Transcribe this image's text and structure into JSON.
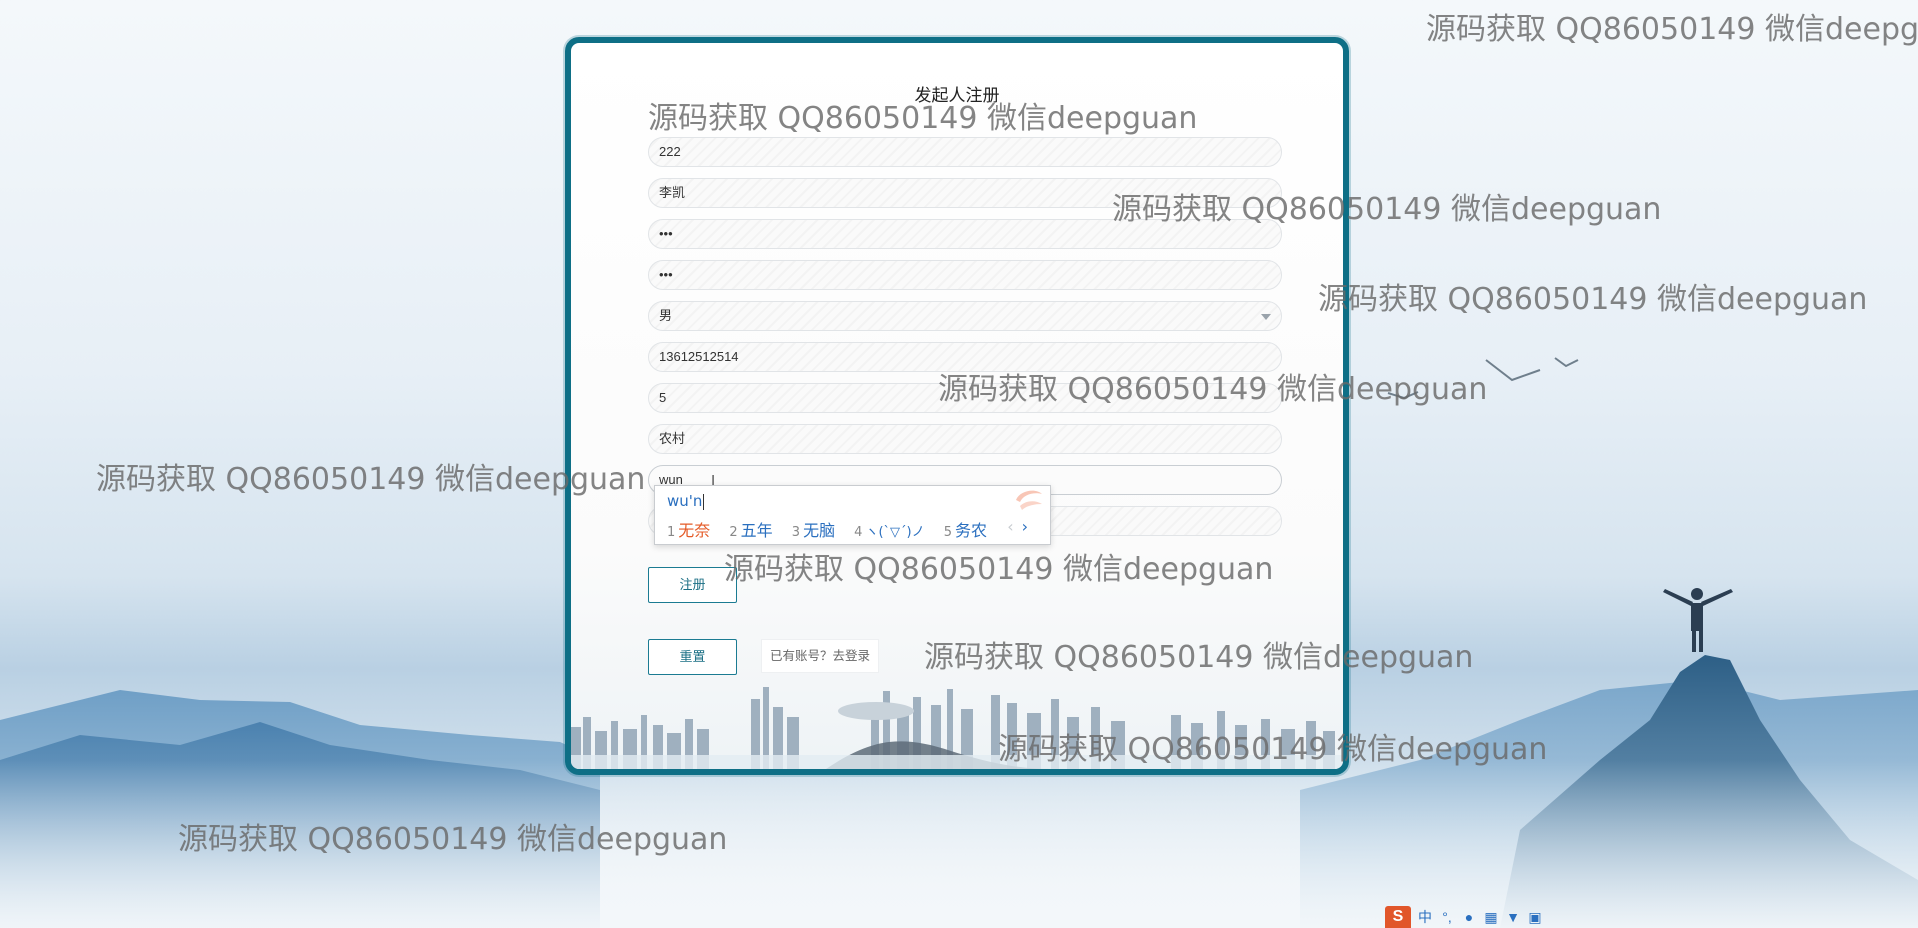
{
  "form": {
    "title": "发起人注册",
    "fields": [
      {
        "name": "account-field",
        "value": "222"
      },
      {
        "name": "name-field",
        "value": "李凯"
      },
      {
        "name": "password-field",
        "value": "•••"
      },
      {
        "name": "confirm-password-field",
        "value": "•••"
      },
      {
        "name": "gender-select",
        "value": "男"
      },
      {
        "name": "phone-field",
        "value": "13612512514"
      },
      {
        "name": "field-7",
        "value": "5"
      },
      {
        "name": "field-8",
        "value": "农村"
      },
      {
        "name": "field-9",
        "value": "wun"
      },
      {
        "name": "field-10",
        "value": ""
      }
    ],
    "register_label": "注册",
    "reset_label": "重置",
    "login_link_label": "已有账号？去登录"
  },
  "ime": {
    "composition": "wu'n",
    "candidates": [
      {
        "num": "1",
        "text": "无奈"
      },
      {
        "num": "2",
        "text": "五年"
      },
      {
        "num": "3",
        "text": "无脑"
      },
      {
        "num": "4",
        "text": "ヽ(ˋ▽ˊ)ノ"
      },
      {
        "num": "5",
        "text": "务农"
      }
    ],
    "prev": "‹",
    "next": "›"
  },
  "watermark": {
    "text": "源码获取 QQ86050149 微信deepguan",
    "text_cut": "源码获取 QQ86050149 微信deepgu"
  },
  "tray": {
    "logo": "S",
    "mode": "中",
    "icons": [
      "punctuation-icon",
      "microphone-icon",
      "keyboard-icon",
      "skin-icon",
      "toolbox-icon"
    ]
  },
  "colors": {
    "accent": "#0e6f86",
    "ime_highlight": "#e45a26",
    "ime_text": "#2a6fbf"
  }
}
